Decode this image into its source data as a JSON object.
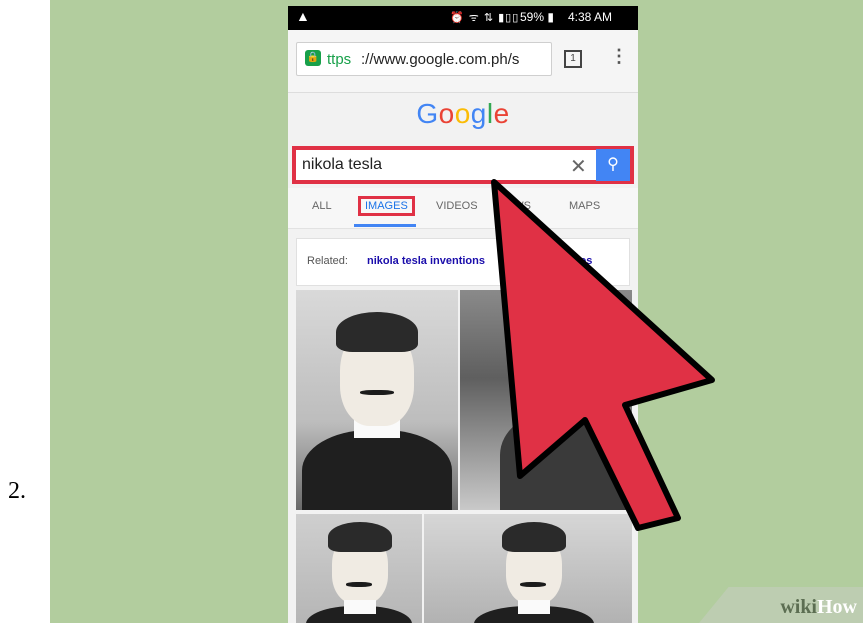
{
  "step": {
    "number": "2."
  },
  "statusbar": {
    "warning": "▲",
    "indicators": "⏰ ᯤ ⇅ ▮▯▯",
    "battery": "59% ▮",
    "time": "4:38 AM"
  },
  "browser": {
    "url_scheme": "ttps",
    "url_rest": "://www.google.com.ph/s",
    "tabs_count": "1",
    "menu": "⋮"
  },
  "google": {
    "logo": [
      {
        "ch": "G",
        "color": "#4285f4"
      },
      {
        "ch": "o",
        "color": "#ea4335"
      },
      {
        "ch": "o",
        "color": "#fbbc05"
      },
      {
        "ch": "g",
        "color": "#4285f4"
      },
      {
        "ch": "l",
        "color": "#34a853"
      },
      {
        "ch": "e",
        "color": "#ea4335"
      }
    ],
    "search_query": "nikola tesla",
    "clear_icon": "✕",
    "search_icon": "⚲"
  },
  "tabs": {
    "all": "ALL",
    "images": "IMAGES",
    "videos": "VIDEOS",
    "news": "NEWS",
    "maps": "MAPS"
  },
  "related": {
    "label": "Related:",
    "link1": "nikola tesla inventions",
    "link2": "uotes"
  },
  "colors": {
    "highlight": "#e03145",
    "background": "#b2cd9e",
    "search_button": "#4285f4"
  },
  "watermark": {
    "wiki": "wiki",
    "how": "How"
  }
}
